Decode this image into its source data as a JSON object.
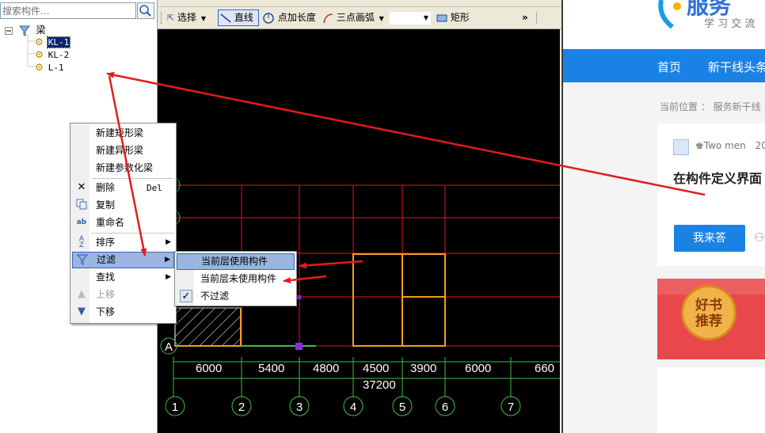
{
  "search": {
    "placeholder": "搜索构件..."
  },
  "tree": {
    "root_label": "梁",
    "children": [
      "KL-1",
      "KL-2",
      "L-1"
    ],
    "selected": "KL-1"
  },
  "toolbar": {
    "select_label": "选择",
    "line_label": "直线",
    "point_length_label": "点加长度",
    "arc_label": "三点画弧",
    "rect_label": "矩形",
    "more": "»"
  },
  "context_menu": {
    "items": [
      {
        "label": "新建矩形梁",
        "icon": ""
      },
      {
        "label": "新建异形梁",
        "icon": ""
      },
      {
        "label": "新建参数化梁",
        "icon": ""
      },
      {
        "label": "删除",
        "shortcut": "Del",
        "icon": "delete-x-icon"
      },
      {
        "label": "复制",
        "icon": "copy-icon"
      },
      {
        "label": "重命名",
        "icon": "rename-icon"
      },
      {
        "label": "排序",
        "icon": "sort-icon",
        "submenu": true
      },
      {
        "label": "过滤",
        "icon": "filter-icon",
        "submenu": true,
        "highlighted": true
      },
      {
        "label": "查找",
        "icon": "",
        "submenu": true
      },
      {
        "label": "上移",
        "icon": "up-arrow-icon",
        "disabled": true
      },
      {
        "label": "下移",
        "icon": "down-arrow-icon"
      }
    ]
  },
  "filter_submenu": {
    "items": [
      {
        "label": "当前层使用构件",
        "highlighted": true
      },
      {
        "label": "当前层未使用构件"
      },
      {
        "label": "不过滤",
        "checked": true
      }
    ]
  },
  "drawing": {
    "dimensions": [
      "6000",
      "5400",
      "4800",
      "4500",
      "3900",
      "6000",
      "660"
    ],
    "total_dimension": "37200",
    "axis_numbers": [
      "1",
      "2",
      "3",
      "4",
      "5",
      "6",
      "7"
    ],
    "axis_letter": "A"
  },
  "web_page": {
    "logo_text": "服务",
    "logo_sub": "学 习 交 流",
    "nav": [
      "首页",
      "新干线头条"
    ],
    "breadcrumb": "当前位置 ： 服务新干线",
    "author": "Two men",
    "date_partial": "20",
    "question_title": "在构件定义界面",
    "answer_button": "我来答",
    "promo_badge_line1": "好书",
    "promo_badge_line2": "推荐"
  },
  "colors": {
    "annotation_arrow": "#e31c1c",
    "grid_line": "#e8141e",
    "beam_outline": "#f0a020",
    "nav_blue": "#1b82e5",
    "selection": "#0a246a"
  }
}
